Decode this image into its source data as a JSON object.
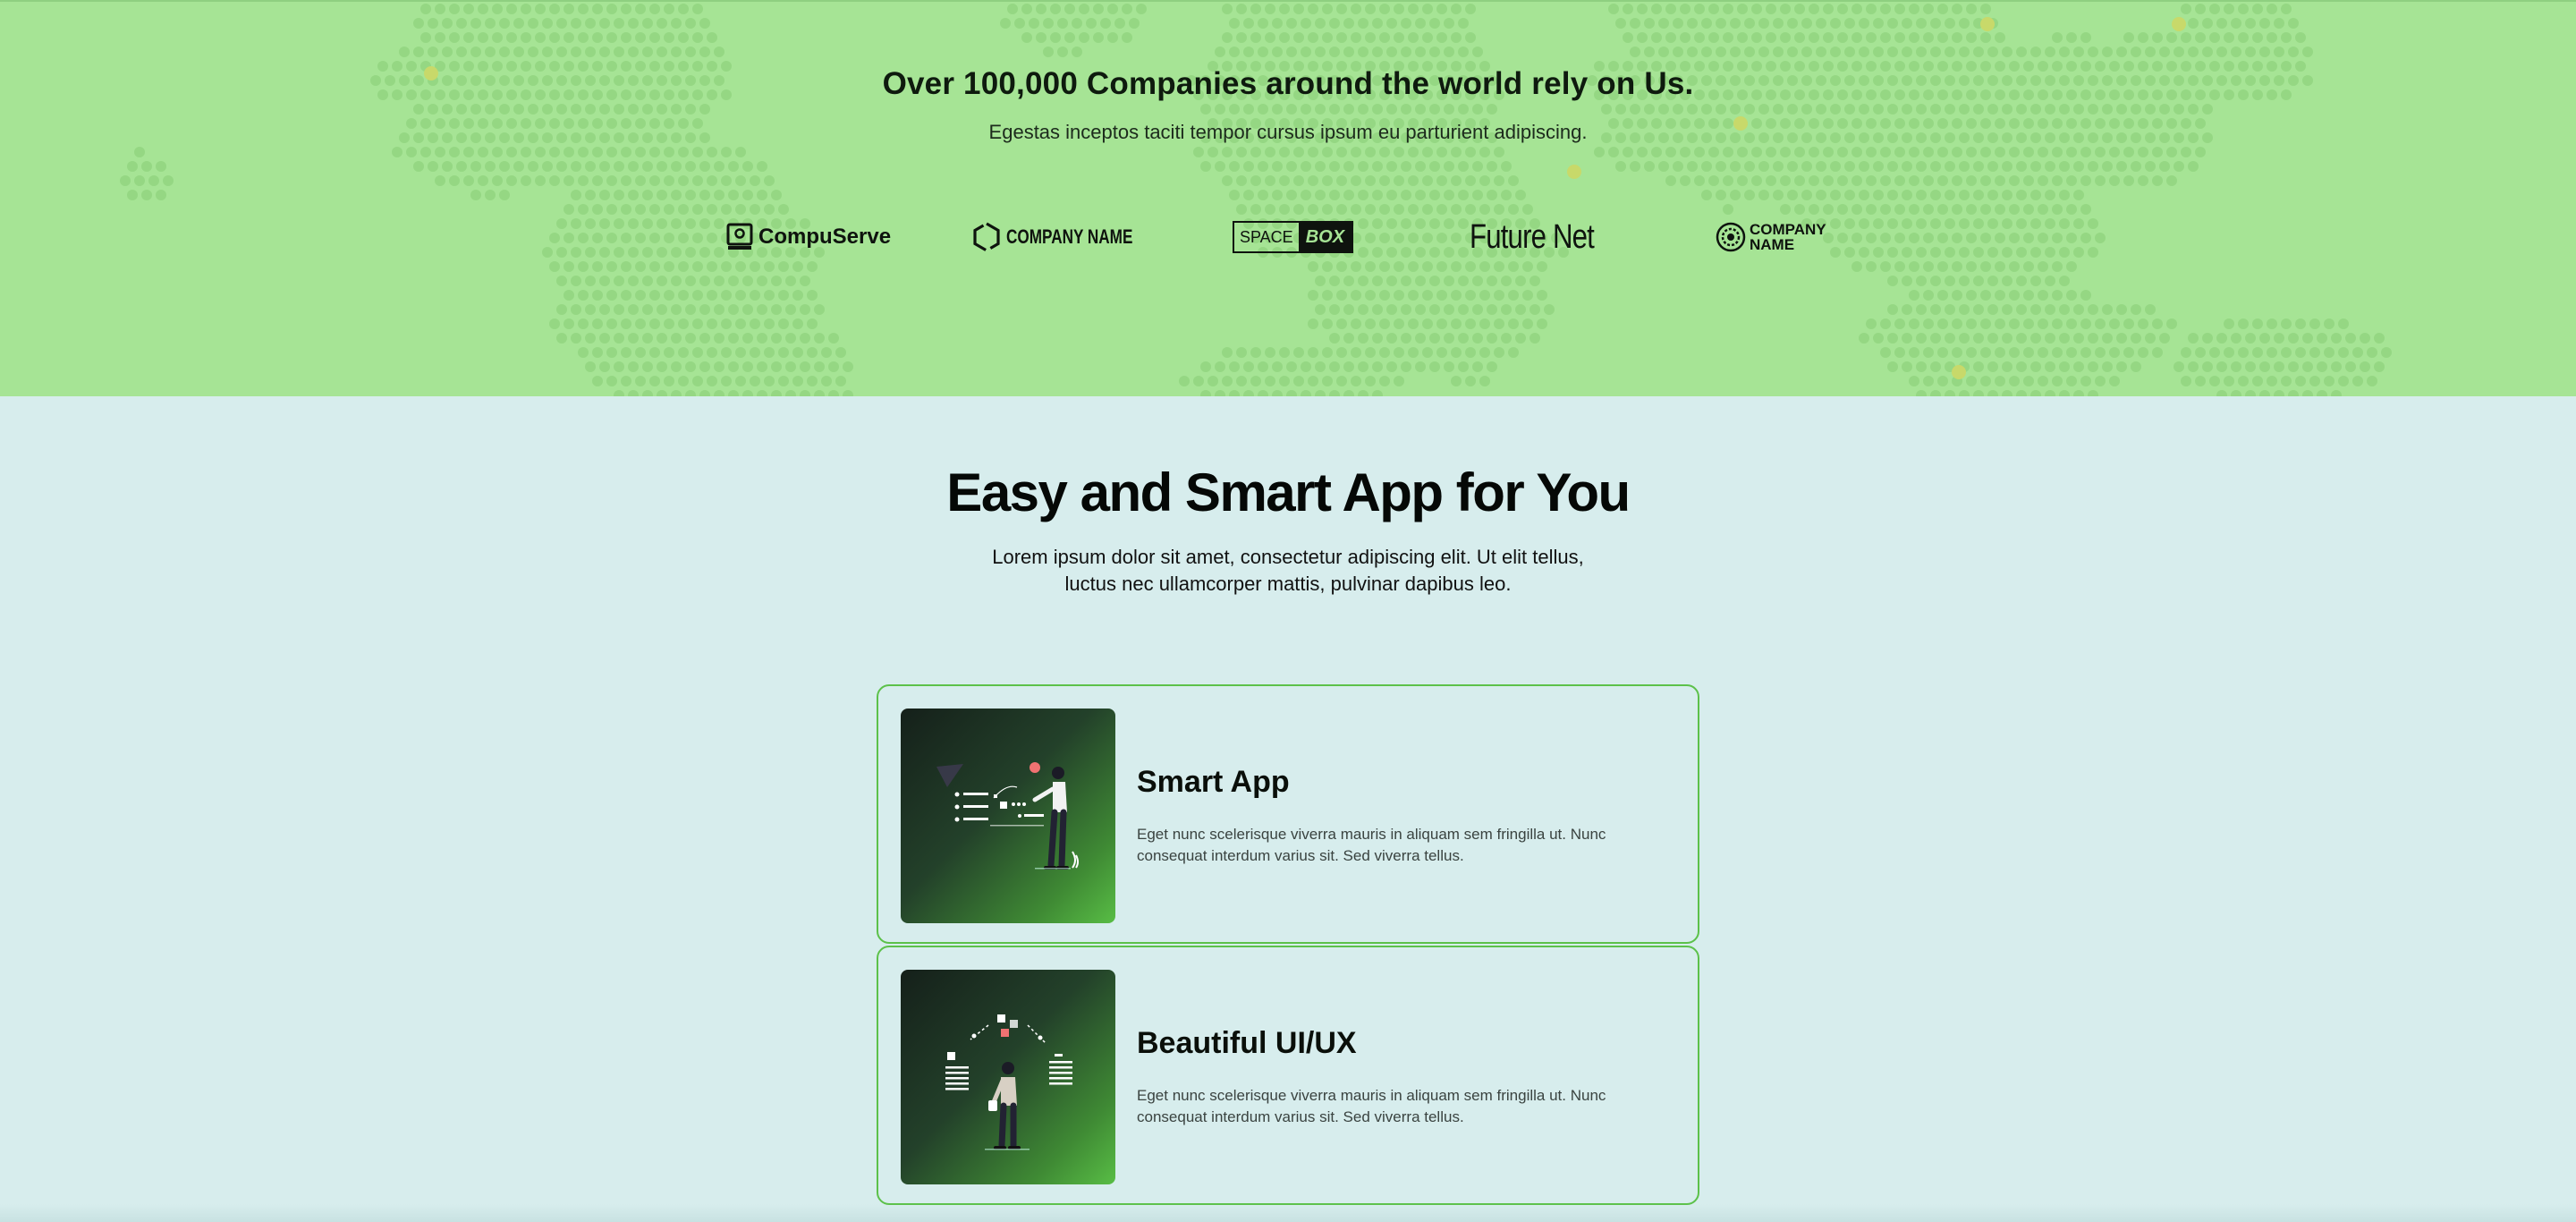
{
  "clients": {
    "title": "Over 100,000 Companies around the world rely on Us.",
    "subtitle": "Egestas inceptos taciti tempor cursus ipsum eu parturient adipiscing.",
    "logos": [
      {
        "text": "CompuServe",
        "icon": "monitor-icon"
      },
      {
        "text": "COMPANY NAME",
        "icon": "hexagon-icon"
      },
      {
        "text_a": "SPACE",
        "text_b": "BOX",
        "icon": "boxed-wordmark"
      },
      {
        "text": "Future Net",
        "icon": "wordmark"
      },
      {
        "text_a": "COMPANY",
        "text_b": "NAME",
        "icon": "gear-emblem-icon"
      }
    ]
  },
  "features": {
    "title": "Easy and Smart App for You",
    "description": "Lorem ipsum dolor sit amet, consectetur adipiscing elit. Ut elit tellus, luctus nec ullamcorper mattis, pulvinar dapibus leo.",
    "cards": [
      {
        "title": "Smart App",
        "text": "Eget nunc scelerisque viverra mauris in aliquam sem fringilla ut. Nunc consequat interdum varius sit. Sed viverra tellus.",
        "illustration": "person-presenting-illustration"
      },
      {
        "title": "Beautiful UI/UX",
        "text": "Eget nunc scelerisque viverra mauris in aliquam sem fringilla ut. Nunc consequat interdum varius sit. Sed viverra tellus.",
        "illustration": "person-with-shapes-illustration"
      }
    ]
  },
  "colors": {
    "band_bg": "#a6e495",
    "page_bg": "#d7eded",
    "accent": "#5cc14a",
    "dot": "#8fd37e",
    "dot_highlight": "#c8d96a"
  }
}
